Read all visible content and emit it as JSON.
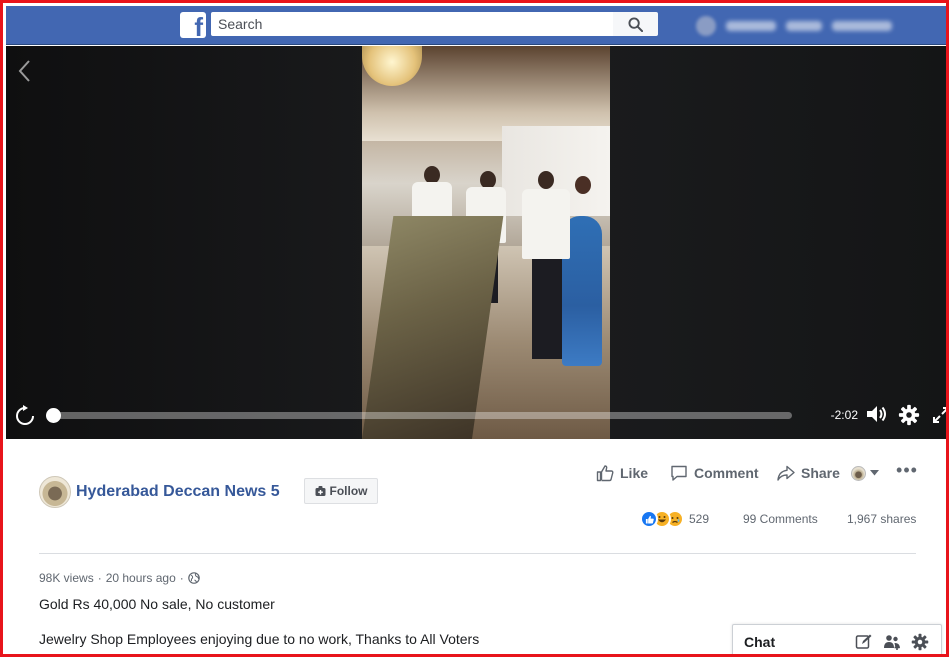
{
  "topbar": {
    "search_placeholder": "Search"
  },
  "video": {
    "time_remaining": "-2:02",
    "progress": 0
  },
  "post": {
    "page_name": "Hyderabad Deccan News 5",
    "follow_label": "Follow",
    "actions": {
      "like": "Like",
      "comment": "Comment",
      "share": "Share"
    },
    "reactions": {
      "types": [
        "like",
        "haha",
        "sad"
      ],
      "count": "529"
    },
    "comments_count": "99 Comments",
    "shares_count": "1,967 shares",
    "meta": {
      "views": "98K views",
      "time": "20 hours ago",
      "audience_icon": "globe-icon"
    },
    "description_line1": "Gold Rs 40,000 No sale, No customer",
    "description_line2": "Jewelry Shop Employees enjoying due to no work, Thanks to All Voters"
  },
  "chat": {
    "label": "Chat"
  },
  "colors": {
    "facebook_blue": "#4267b2",
    "link_blue": "#365899",
    "frame_red": "#e8141b"
  }
}
